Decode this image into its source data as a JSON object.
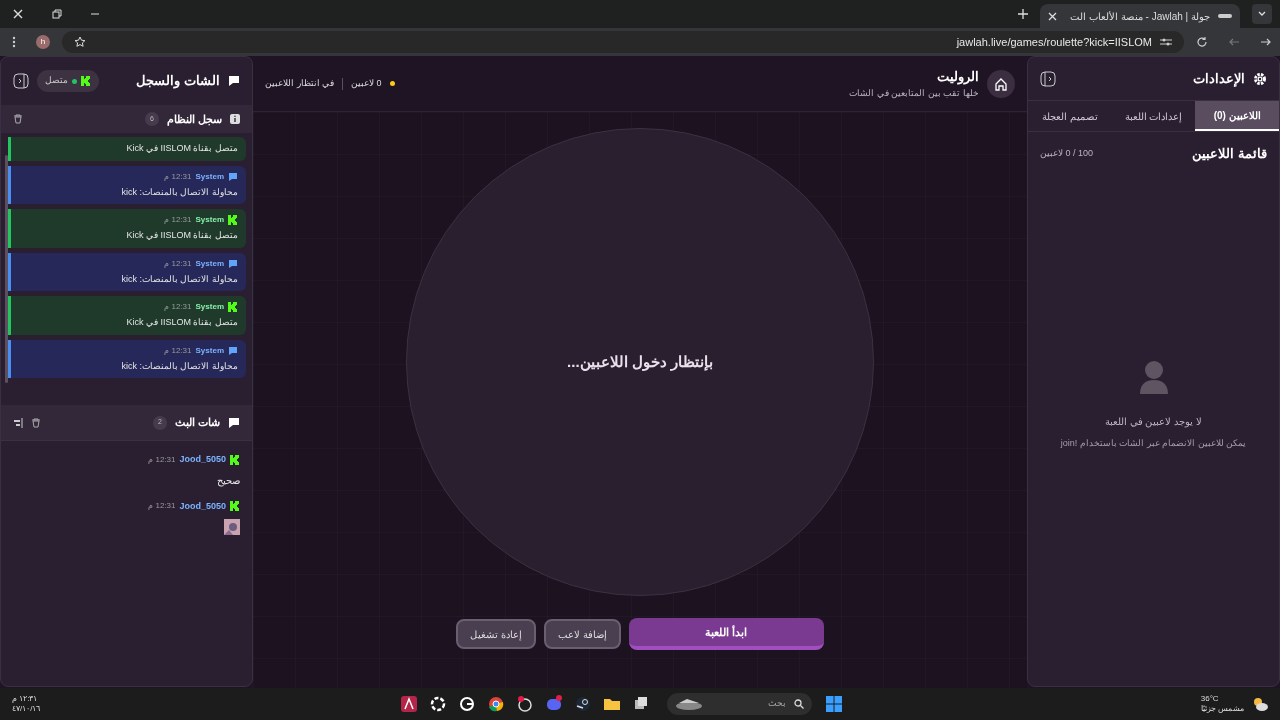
{
  "browser": {
    "tab_title": "جولة | Jawlah - منصة الألعاب الت",
    "url": "jawlah.live/games/roulette?kick=IISLOM",
    "profile": "h"
  },
  "settings_panel": {
    "title": "الإعدادات",
    "tabs": [
      {
        "label": "اللاعبين (0)",
        "selected": true
      },
      {
        "label": "إعدادات اللعبة",
        "selected": false
      },
      {
        "label": "تصميم العجلة",
        "selected": false
      }
    ],
    "list_title": "قائمة اللاعبين",
    "list_count": "100 / 0 لاعبين",
    "empty_title": "لا يوجد لاعبين في اللعبة",
    "empty_hint": "يمكن للاعبين الانضمام عبر الشات باستخدام !join"
  },
  "game": {
    "title": "الروليت",
    "subtitle": "خلها تقب بين المتابعين في الشات",
    "players": "0 لاعبين",
    "status": "في انتظار اللاعبين",
    "wheel_text": "بإنتظار دخول اللاعبين...",
    "buttons": [
      {
        "label": "ابدأ اللعبة",
        "kind": "primary"
      },
      {
        "label": "إضافة لاعب",
        "kind": "secondary"
      },
      {
        "label": "إعادة تشغيل",
        "kind": "secondary"
      }
    ]
  },
  "chat_panel": {
    "title": "الشات والسجل",
    "connection": "متصل",
    "system_log": {
      "title": "سجل النظام",
      "count": "6",
      "entries": [
        {
          "kind": "connected",
          "text": "متصل بقناة IISLOM في Kick"
        },
        {
          "kind": "connecting",
          "sender": "System",
          "time": "12:31 م",
          "text": "محاولة الاتصال بالمنصات: kick"
        },
        {
          "kind": "connected",
          "sender": "System",
          "time": "12:31 م",
          "text": "متصل بقناة IISLOM في Kick"
        },
        {
          "kind": "connecting",
          "sender": "System",
          "time": "12:31 م",
          "text": "محاولة الاتصال بالمنصات: kick"
        },
        {
          "kind": "connected",
          "sender": "System",
          "time": "12:31 م",
          "text": "متصل بقناة IISLOM في Kick"
        },
        {
          "kind": "connecting",
          "sender": "System",
          "time": "12:31 م",
          "text": "محاولة الاتصال بالمنصات: kick"
        }
      ]
    },
    "stream_chat": {
      "title": "شات البث",
      "count": "2",
      "messages": [
        {
          "kind": "text",
          "user": "Jood_5050",
          "time": "12:31 م",
          "text": "صحيح"
        },
        {
          "user": "Jood_5050",
          "time": "12:31 م"
        }
      ]
    }
  },
  "taskbar": {
    "search_placeholder": "بحث",
    "temperature": "36°C",
    "weather": "مشمس جزئيًا",
    "time": "١٢:٣١ م",
    "date": "٤٧/١٠/١٦"
  }
}
